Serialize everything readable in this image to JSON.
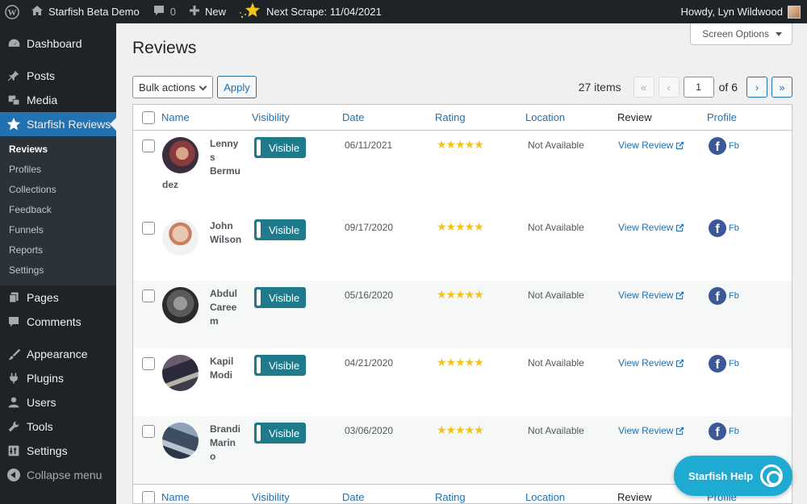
{
  "adminbar": {
    "site_name": "Starfish Beta Demo",
    "comments_count": "0",
    "new_label": "New",
    "next_scrape": "Next Scrape: 11/04/2021",
    "howdy": "Howdy, Lyn Wildwood"
  },
  "sidebar": {
    "items": [
      {
        "label": "Dashboard",
        "icon": "dashboard-icon"
      },
      {
        "label": "Posts",
        "icon": "pin-icon"
      },
      {
        "label": "Media",
        "icon": "media-icon"
      },
      {
        "label": "Starfish Reviews",
        "icon": "star-icon"
      },
      {
        "label": "Pages",
        "icon": "page-icon"
      },
      {
        "label": "Comments",
        "icon": "comment-icon"
      },
      {
        "label": "Appearance",
        "icon": "brush-icon"
      },
      {
        "label": "Plugins",
        "icon": "plug-icon"
      },
      {
        "label": "Users",
        "icon": "user-icon"
      },
      {
        "label": "Tools",
        "icon": "wrench-icon"
      },
      {
        "label": "Settings",
        "icon": "settings-icon"
      },
      {
        "label": "Collapse menu",
        "icon": "collapse-icon"
      }
    ],
    "submenu": [
      "Reviews",
      "Profiles",
      "Collections",
      "Feedback",
      "Funnels",
      "Reports",
      "Settings"
    ]
  },
  "screen_options": "Screen Options",
  "page_title": "Reviews",
  "bulk_actions": "Bulk actions",
  "apply": "Apply",
  "pagination": {
    "items": "27 items",
    "first": "«",
    "prev": "‹",
    "current_page": "1",
    "of": "of 6",
    "next": "›",
    "last": "»"
  },
  "columns": {
    "name": "Name",
    "visibility": "Visibility",
    "date": "Date",
    "rating": "Rating",
    "location": "Location",
    "review": "Review",
    "profile": "Profile"
  },
  "rows": [
    {
      "name_lines": [
        "Lenny",
        "s",
        "Bermu",
        "dez"
      ],
      "visibility": "Visible",
      "date": "06/11/2021",
      "stars": "★★★★★",
      "location": "Not Available",
      "review_link": "View Review",
      "profile": "Fb"
    },
    {
      "name_lines": [
        "John",
        "Wilson"
      ],
      "visibility": "Visible",
      "date": "09/17/2020",
      "stars": "★★★★★",
      "location": "Not Available",
      "review_link": "View Review",
      "profile": "Fb"
    },
    {
      "name_lines": [
        "Abdul",
        "Caree",
        "m"
      ],
      "visibility": "Visible",
      "date": "05/16/2020",
      "stars": "★★★★★",
      "location": "Not Available",
      "review_link": "View Review",
      "profile": "Fb"
    },
    {
      "name_lines": [
        "Kapil",
        "Modi"
      ],
      "visibility": "Visible",
      "date": "04/21/2020",
      "stars": "★★★★★",
      "location": "Not Available",
      "review_link": "View Review",
      "profile": "Fb"
    },
    {
      "name_lines": [
        "Brandi",
        "Marin",
        "o"
      ],
      "visibility": "Visible",
      "date": "03/06/2020",
      "stars": "★★★★★",
      "location": "Not Available",
      "review_link": "View Review",
      "profile": "Fb"
    }
  ],
  "help_button": "Starfish Help",
  "colors": {
    "accent": "#2271b1",
    "toggle": "#1f7a8c",
    "help": "#1eaad1",
    "star": "#f0c419"
  }
}
